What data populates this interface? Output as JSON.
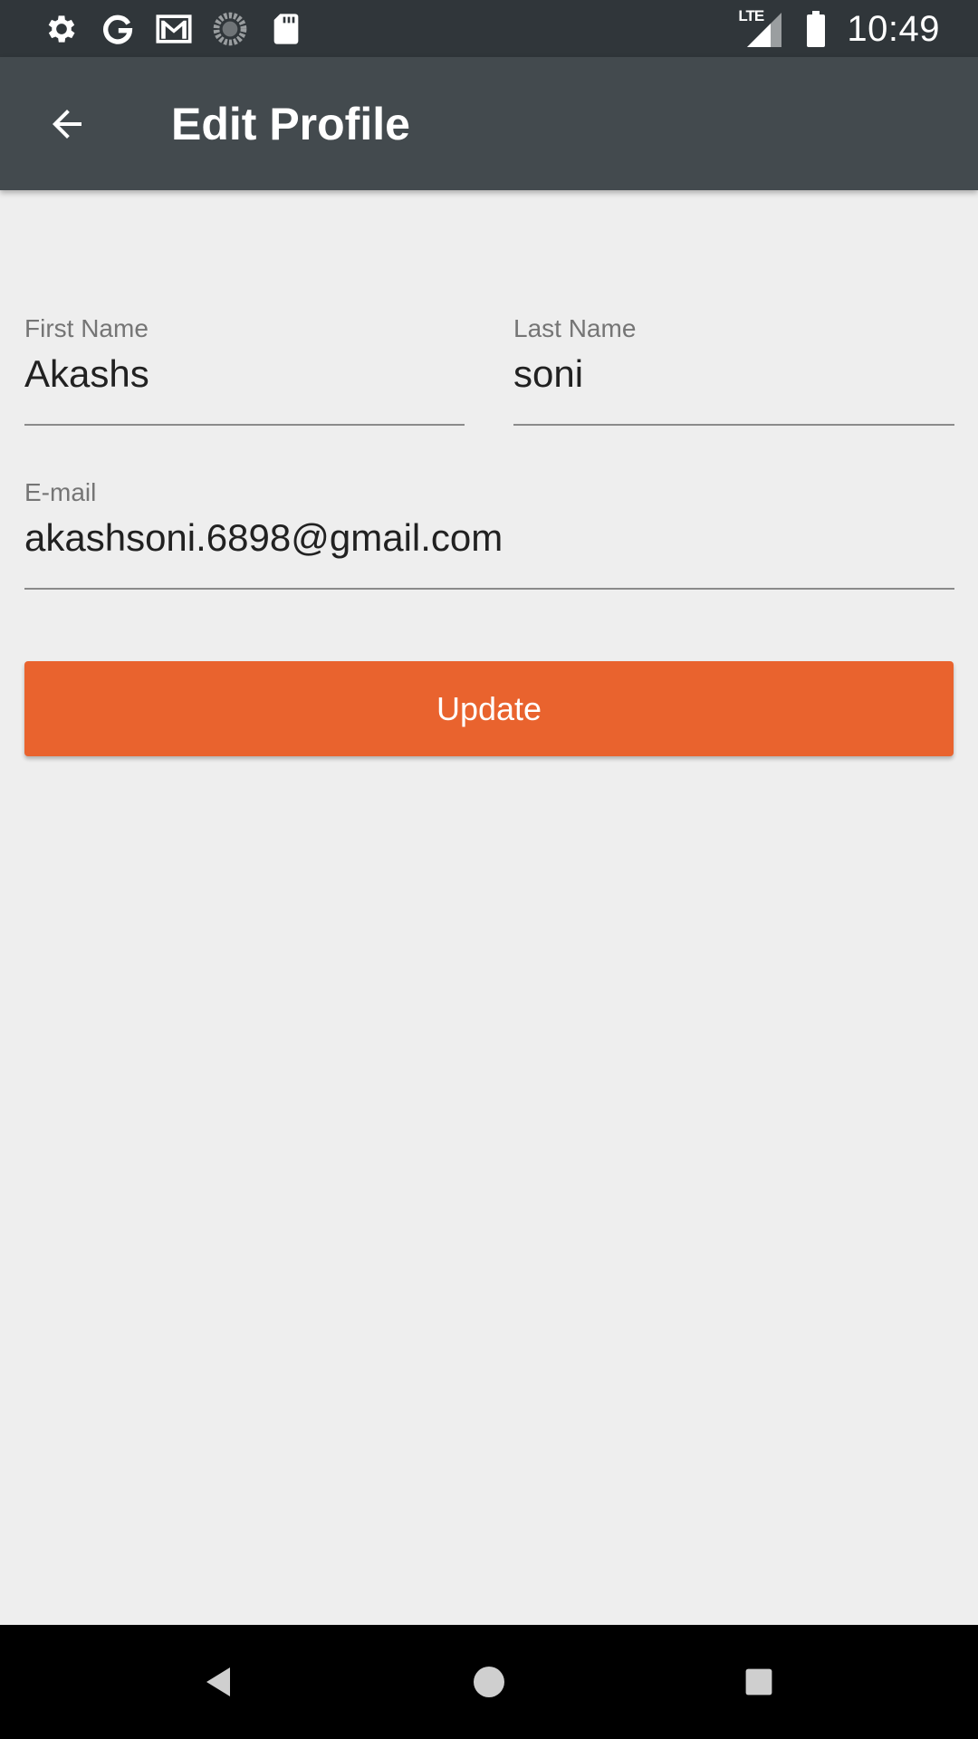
{
  "status_bar": {
    "time": "10:49",
    "network_label": "LTE",
    "icons_left": [
      "gear-icon",
      "google-icon",
      "gmail-icon",
      "sync-spinner-icon",
      "sd-card-icon"
    ],
    "icons_right": [
      "lte-signal-icon",
      "battery-icon"
    ]
  },
  "app_bar": {
    "title": "Edit Profile",
    "back_icon": "arrow-back-icon"
  },
  "form": {
    "first_name": {
      "label": "First Name",
      "value": "Akashs"
    },
    "last_name": {
      "label": "Last Name",
      "value": "soni"
    },
    "email": {
      "label": "E-mail",
      "value": "akashsoni.6898@gmail.com"
    },
    "submit_label": "Update"
  },
  "nav_bar": {
    "icons": [
      "nav-back-icon",
      "nav-home-icon",
      "nav-recents-icon"
    ]
  },
  "colors": {
    "status_bar": "#30363a",
    "app_bar": "#434a4e",
    "background": "#eeeeee",
    "accent": "#e9632e"
  }
}
